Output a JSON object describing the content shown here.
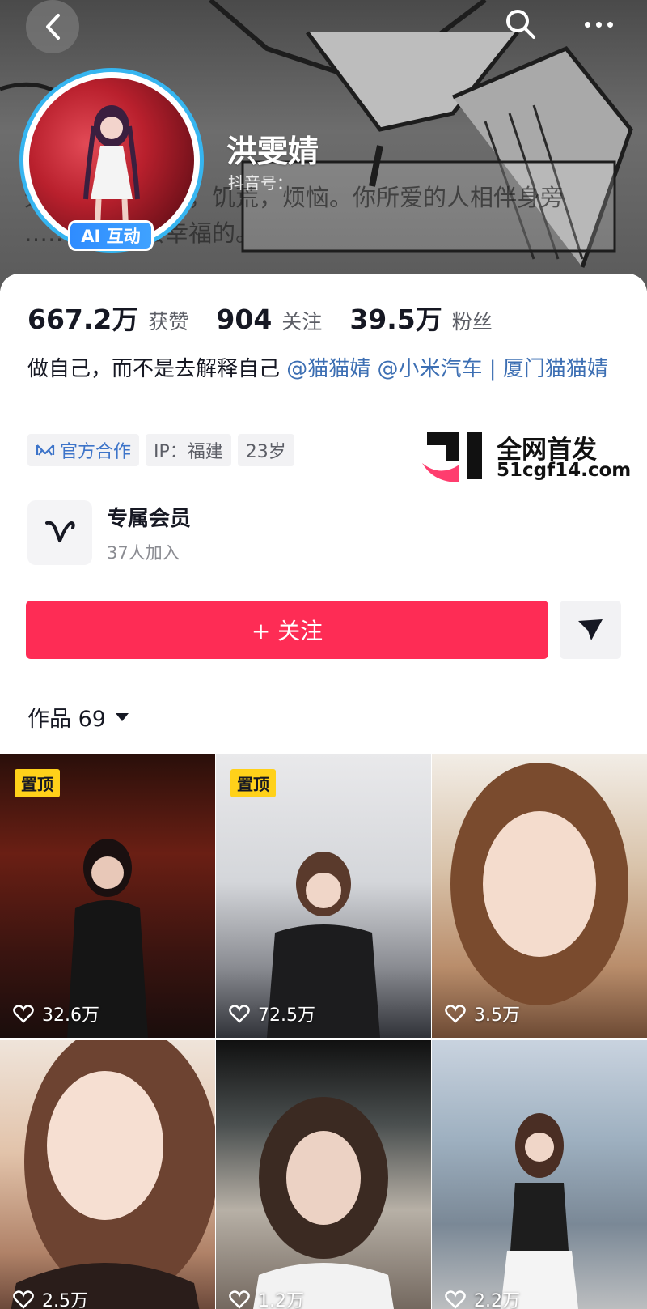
{
  "header": {
    "nickname": "洪雯婧",
    "douyin_id_label": "抖音号：",
    "background_text_line1": "无可奈何，抗争，饥荒，烦恼。你所爱的人相伴身旁",
    "background_text_line2": "……的你也会幸福的。",
    "ai_badge": "AI 互动"
  },
  "stats": [
    {
      "value": "667.2万",
      "label": "获赞"
    },
    {
      "value": "904",
      "label": "关注"
    },
    {
      "value": "39.5万",
      "label": "粉丝"
    }
  ],
  "bio": {
    "text": "做自己，而不是去解释自己 ",
    "mention1": "@猫猫婧",
    "mention2": " @小米汽车 | 厦门猫猫婧"
  },
  "tags": {
    "official": "官方合作",
    "ip": "IP：福建",
    "age": "23岁"
  },
  "watermark": {
    "title": "全网首发",
    "url": "51cgf14.com"
  },
  "member": {
    "title": "专属会员",
    "subtitle": "37人加入"
  },
  "actions": {
    "follow": "+ 关注"
  },
  "works": {
    "label": "作品 69"
  },
  "videos": [
    {
      "pinned": "置顶",
      "likes": "32.6万"
    },
    {
      "pinned": "置顶",
      "likes": "72.5万"
    },
    {
      "pinned": "",
      "likes": "3.5万"
    },
    {
      "pinned": "",
      "likes": "2.5万"
    },
    {
      "pinned": "",
      "likes": "1.2万"
    },
    {
      "pinned": "",
      "likes": "2.2万"
    }
  ],
  "colors": {
    "follow_button": "#fe2c55",
    "mention": "#3d6fb3",
    "avatar_ring": "#36b5f0",
    "pin_badge": "#ffd11a"
  }
}
